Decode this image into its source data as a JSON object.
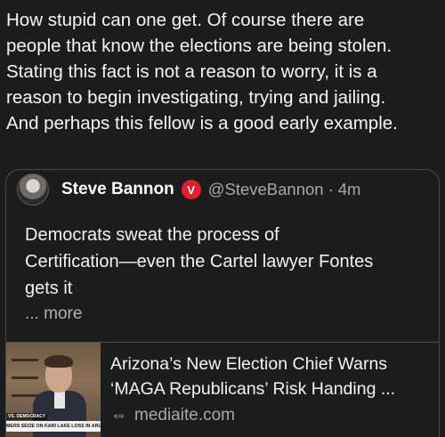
{
  "post": {
    "text_lines": [
      "How stupid can one get. Of course there are",
      "people that know the elections are being stolen.",
      "Stating this fact is not a reason to worry, it is a",
      "reason to begin investigating, trying and jailing.",
      "And perhaps this fellow is a good early example."
    ]
  },
  "quote": {
    "author_name": "Steve Bannon",
    "verified_badge": "V",
    "handle": "@SteveBannon",
    "separator": "·",
    "age": "4m",
    "body_lines": [
      "Democrats sweat the process of",
      "Certification—even the Cartel lawyer Fontes",
      "gets it"
    ],
    "more_label": "... more",
    "icons": {
      "avatar": "avatar",
      "verified": "verified-badge-icon"
    }
  },
  "link_preview": {
    "title_lines": [
      "Arizona’s New Election Chief Warns",
      "‘MAGA Republicans’ Risk Handing ..."
    ],
    "domain": "mediaite.com",
    "link_icon": "⇔",
    "thumbnail": {
      "chyron_tag": "VS. DEMOCRACY",
      "chyron_text": "MERS SEIZE ON KARI LAKE LOSS IN ARIZONA"
    }
  },
  "colors": {
    "background": "#1c1c1c",
    "text": "#f2f2f2",
    "secondary_text": "#a8a8a8",
    "border": "#4a4a4a",
    "badge_red": "#e41e2f"
  }
}
